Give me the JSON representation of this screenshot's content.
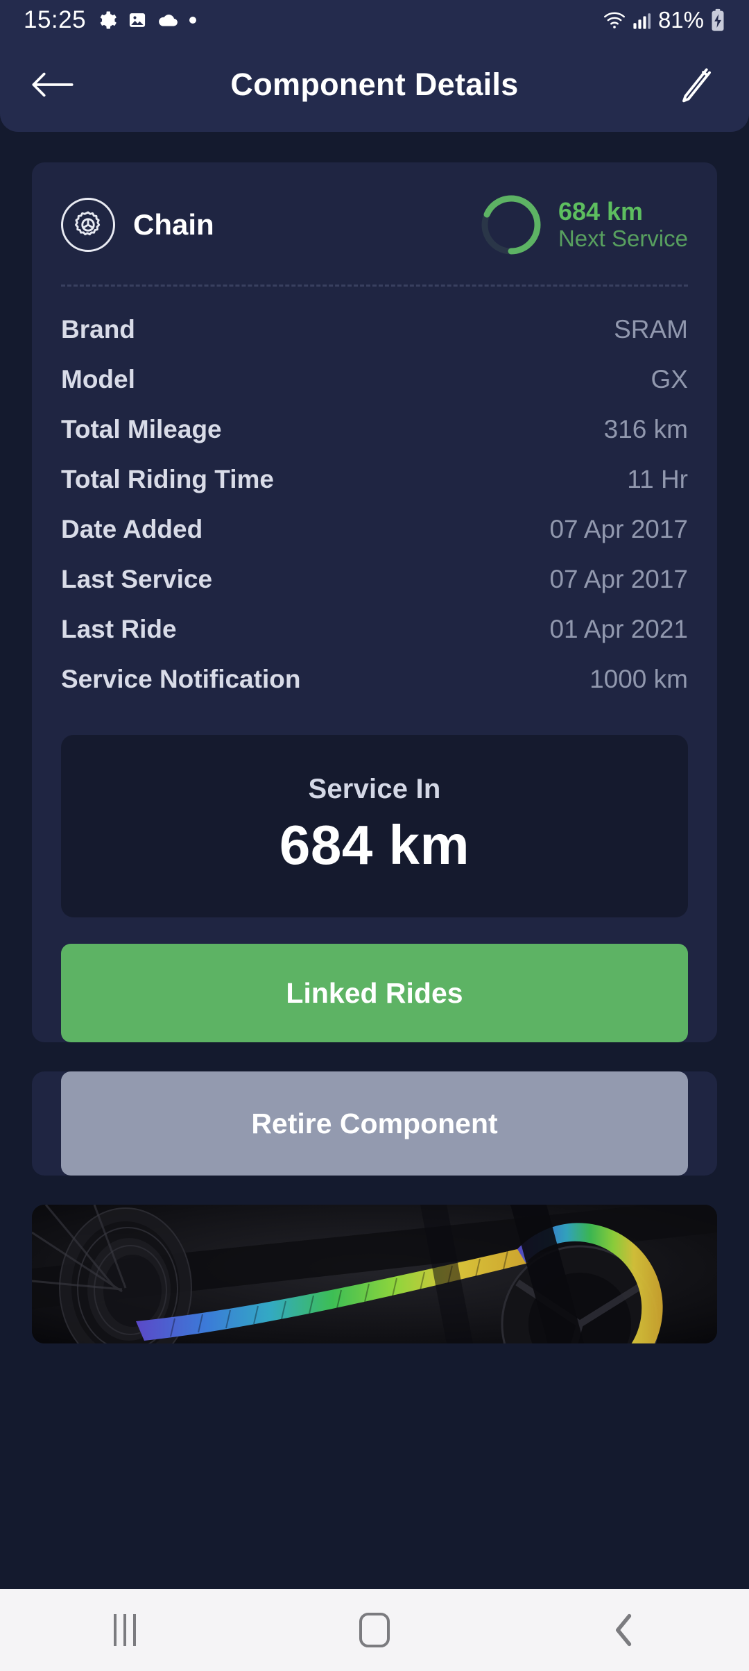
{
  "status_bar": {
    "time": "15:25",
    "battery_percent": "81%",
    "left_icons": [
      "gear-icon",
      "image-icon",
      "cloud-icon",
      "dot-icon"
    ],
    "right_icons": [
      "wifi-icon",
      "cellular-signal-icon",
      "battery-charging-icon"
    ]
  },
  "app_bar": {
    "title": "Component Details",
    "back_icon": "arrow-left-icon",
    "edit_icon": "pencil-icon"
  },
  "component": {
    "icon": "gear-in-circle-icon",
    "name": "Chain",
    "next_service": {
      "value": "684 km",
      "label": "Next Service",
      "progress_percent": 68.4,
      "ring_color": "#5DB364",
      "ring_track_color": "#2A3648"
    }
  },
  "specs": [
    {
      "label": "Brand",
      "value": "SRAM"
    },
    {
      "label": "Model",
      "value": "GX"
    },
    {
      "label": "Total Mileage",
      "value": "316 km"
    },
    {
      "label": "Total Riding Time",
      "value": "11 Hr"
    },
    {
      "label": "Date Added",
      "value": "07 Apr 2017"
    },
    {
      "label": "Last Service",
      "value": "07 Apr 2017"
    },
    {
      "label": "Last Ride",
      "value": "01 Apr 2021"
    },
    {
      "label": "Service Notification",
      "value": "1000 km"
    }
  ],
  "service_box": {
    "label": "Service In",
    "value": "684 km"
  },
  "actions": {
    "linked_rides_label": "Linked Rides",
    "linked_rides_color": "#5DB364",
    "retire_label": "Retire Component",
    "retire_color": "#939AAF"
  },
  "photo": {
    "alt": "bicycle drivetrain with rainbow colored chain"
  },
  "nav_bar": {
    "recents_icon": "recents-icon",
    "home_icon": "home-icon",
    "back_icon": "chevron-left-icon"
  },
  "colors": {
    "page_background": "#141A2E",
    "header_background": "#242B4D",
    "card_background": "#1F2542",
    "inner_box_background": "#151A2E",
    "label_text": "#D9DCE8",
    "value_text": "#9198AE",
    "accent_green": "#5DB364"
  }
}
